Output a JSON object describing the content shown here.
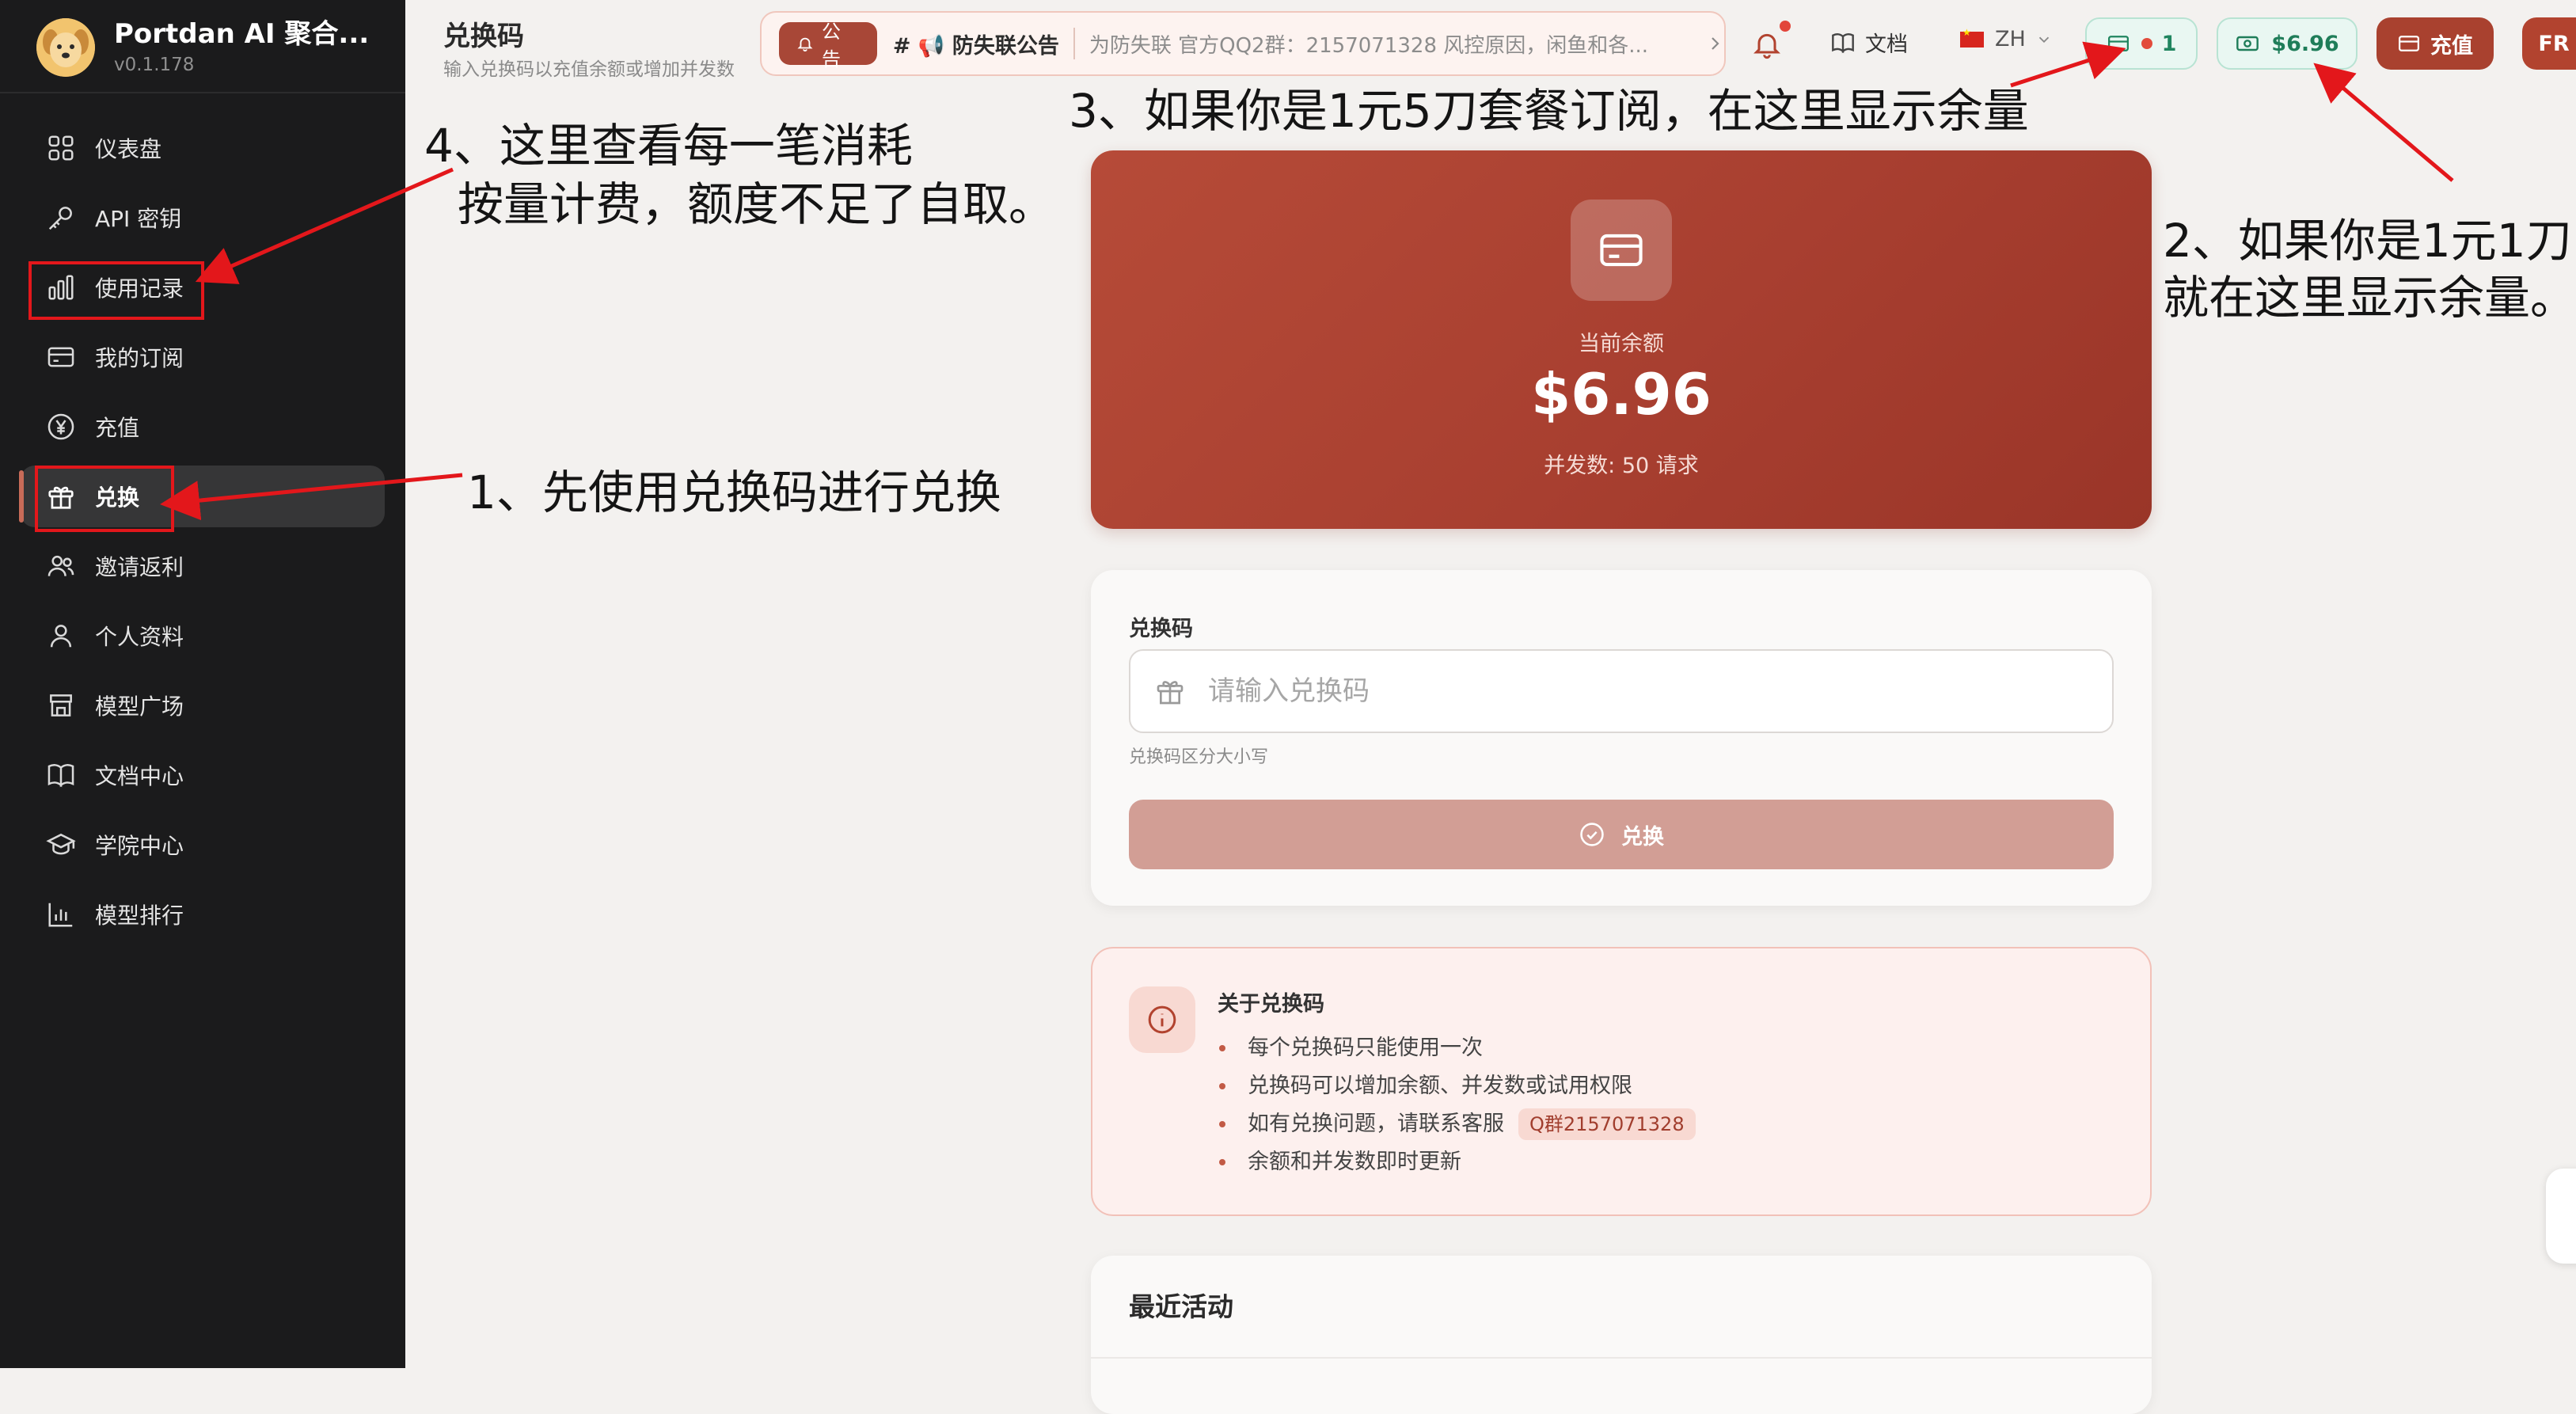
{
  "brand": {
    "name": "Portdan AI 聚合...",
    "version": "v0.1.178"
  },
  "sidebar": {
    "items": [
      {
        "label": "仪表盘",
        "icon": "grid-icon",
        "active": false
      },
      {
        "label": "API 密钥",
        "icon": "key-icon",
        "active": false
      },
      {
        "label": "使用记录",
        "icon": "bar-chart-icon",
        "active": false
      },
      {
        "label": "我的订阅",
        "icon": "card-icon",
        "active": false
      },
      {
        "label": "充值",
        "icon": "yen-icon",
        "active": false
      },
      {
        "label": "兑换",
        "icon": "gift-icon",
        "active": true
      },
      {
        "label": "邀请返利",
        "icon": "users-icon",
        "active": false
      },
      {
        "label": "个人资料",
        "icon": "user-icon",
        "active": false
      },
      {
        "label": "模型广场",
        "icon": "store-icon",
        "active": false
      },
      {
        "label": "文档中心",
        "icon": "book-icon",
        "active": false
      },
      {
        "label": "学院中心",
        "icon": "graduation-cap-icon",
        "active": false
      },
      {
        "label": "模型排行",
        "icon": "ranking-chart-icon",
        "active": false
      }
    ]
  },
  "header": {
    "title": "兑换码",
    "subtitle": "输入兑换码以充值余额或增加并发数",
    "announcement": {
      "badge": "公告",
      "title": "# 📢 防失联公告",
      "text": "为防失联 官方QQ2群：2157071328 风控原因，闲鱼和各..."
    },
    "docs_label": "文档",
    "lang_label": "ZH",
    "subscription_count": "1",
    "balance": "$6.96",
    "topup_label": "充值",
    "user_initials": "FR"
  },
  "balance_card": {
    "label": "当前余额",
    "value": "$6.96",
    "concurrency": "并发数: 50 请求"
  },
  "redeem": {
    "label": "兑换码",
    "placeholder": "请输入兑换码",
    "hint": "兑换码区分大小写",
    "button": "兑换"
  },
  "about": {
    "title": "关于兑换码",
    "items": [
      "每个兑换码只能使用一次",
      "兑换码可以增加余额、并发数或试用权限",
      "如有兑换问题，请联系客服",
      "余额和并发数即时更新"
    ],
    "qq_pill": "Q群2157071328"
  },
  "recent": {
    "title": "最近活动"
  },
  "annotations": {
    "a1": "1、先使用兑换码进行兑换",
    "a2_line1": "2、如果你是1元1刀",
    "a2_line2": "就在这里显示余量。",
    "a3": "3、如果你是1元5刀套餐订阅，在这里显示余量",
    "a4_line1": "4、这里查看每一笔消耗",
    "a4_line2": "按量计费，额度不足了自取。"
  },
  "colors": {
    "accent": "#a9412f",
    "sidebar_bg": "#1b1b1c",
    "balance_green": "#1f7d59",
    "annotation_red": "#e3171b"
  }
}
